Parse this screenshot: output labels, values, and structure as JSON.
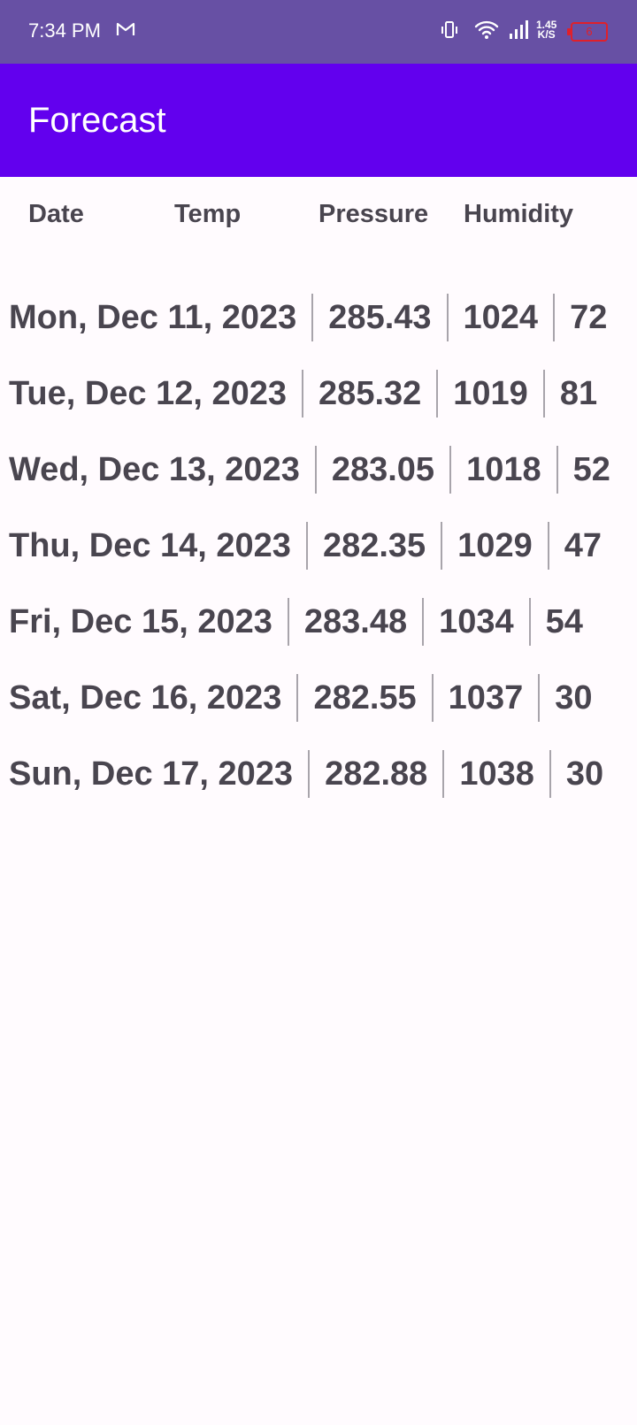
{
  "status_bar": {
    "time": "7:34 PM",
    "speed_value": "1.45",
    "speed_unit": "K/S",
    "battery": "6"
  },
  "app_bar": {
    "title": "Forecast"
  },
  "table": {
    "headers": [
      "Date",
      "Temp",
      "Pressure",
      "Humidity"
    ],
    "rows": [
      {
        "date": "Mon, Dec 11, 2023",
        "temp": "285.43",
        "pressure": "1024",
        "humidity": "72"
      },
      {
        "date": "Tue, Dec 12, 2023",
        "temp": "285.32",
        "pressure": "1019",
        "humidity": "81"
      },
      {
        "date": "Wed, Dec 13, 2023",
        "temp": "283.05",
        "pressure": "1018",
        "humidity": "52"
      },
      {
        "date": "Thu, Dec 14, 2023",
        "temp": "282.35",
        "pressure": "1029",
        "humidity": "47"
      },
      {
        "date": "Fri, Dec 15, 2023",
        "temp": "283.48",
        "pressure": "1034",
        "humidity": "54"
      },
      {
        "date": "Sat, Dec 16, 2023",
        "temp": "282.55",
        "pressure": "1037",
        "humidity": "30"
      },
      {
        "date": "Sun, Dec 17, 2023",
        "temp": "282.88",
        "pressure": "1038",
        "humidity": "30"
      }
    ]
  },
  "colors": {
    "status_bar": "#6750a4",
    "app_bar": "#6200ee",
    "text": "#49454f",
    "battery_low": "#e0202a"
  }
}
